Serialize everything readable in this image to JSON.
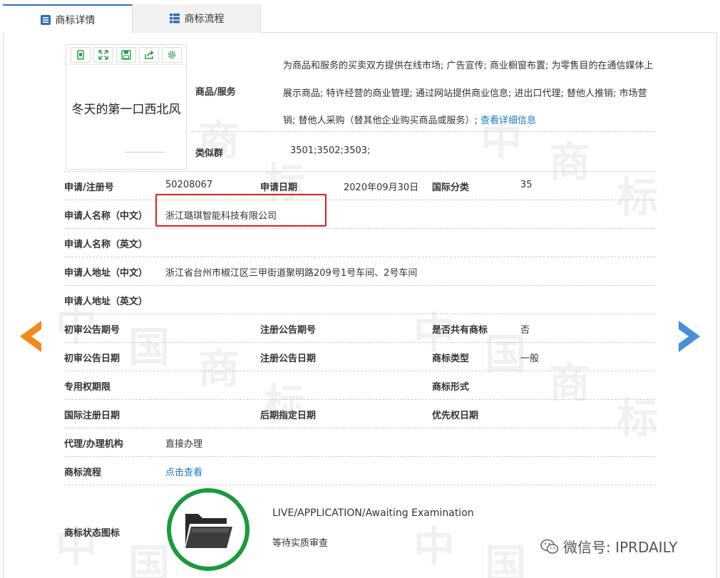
{
  "tabs": {
    "detail": "商标详情",
    "flow": "商标流程"
  },
  "logo": {
    "text": "冬天的第一口西北风",
    "tools": [
      "copy-icon",
      "expand-icon",
      "save-icon",
      "share-icon",
      "settings-icon"
    ]
  },
  "goods": {
    "label": "商品/服务",
    "text": "为商品和服务的买卖双方提供在线市场; 广告宣传; 商业橱窗布置; 为零售目的在通信媒体上展示商品; 特许经营的商业管理; 通过网站提供商业信息; 进出口代理; 替他人推销; 市场营销; 替他人采购（替其他企业购买商品或服务）; ",
    "more_link": "查看详细信息"
  },
  "similar": {
    "label": "类似群",
    "value": "3501;3502;3503;"
  },
  "fields": {
    "reg_no_label": "申请/注册号",
    "reg_no": "50208067",
    "apply_date_label": "申请日期",
    "apply_date": "2020年09月30日",
    "intl_class_label": "国际分类",
    "intl_class": "35",
    "applicant_cn_label": "申请人名称（中文）",
    "applicant_cn": "浙江璐琪智能科技有限公司",
    "applicant_en_label": "申请人名称（英文）",
    "applicant_en": "",
    "address_cn_label": "申请人地址（中文）",
    "address_cn": "浙江省台州市椒江区三甲街道聚明路209号1号车间、2号车间",
    "address_en_label": "申请人地址（英文）",
    "address_en": "",
    "prelim_no_label": "初审公告期号",
    "prelim_no": "",
    "reg_pub_no_label": "注册公告期号",
    "reg_pub_no": "",
    "shared_label": "是否共有商标",
    "shared": "否",
    "prelim_date_label": "初审公告日期",
    "prelim_date": "",
    "reg_pub_date_label": "注册公告日期",
    "reg_pub_date": "",
    "type_label": "商标类型",
    "type": "一般",
    "exclusive_label": "专用权期限",
    "exclusive": "",
    "form_label": "商标形式",
    "form": "",
    "intl_reg_date_label": "国际注册日期",
    "intl_reg_date": "",
    "later_date_label": "后期指定日期",
    "later_date": "",
    "priority_label": "优先权日期",
    "priority": "",
    "agent_label": "代理/办理机构",
    "agent": "直接办理",
    "flow_label": "商标流程",
    "flow_link": "点击查看",
    "status_icon_label": "商标状态图标"
  },
  "status": {
    "en": "LIVE/APPLICATION/Awaiting Examination",
    "cn": "等待实质审查"
  },
  "watermark": {
    "wechat": "微信号: IPRDAILY"
  },
  "colors": {
    "accent": "#2e6db5",
    "link": "#1a7bc4",
    "highlight": "#e02020",
    "status_ring": "#1a9a3c",
    "prev_arrow": "#f08a1c",
    "next_arrow": "#4a8fd4"
  }
}
